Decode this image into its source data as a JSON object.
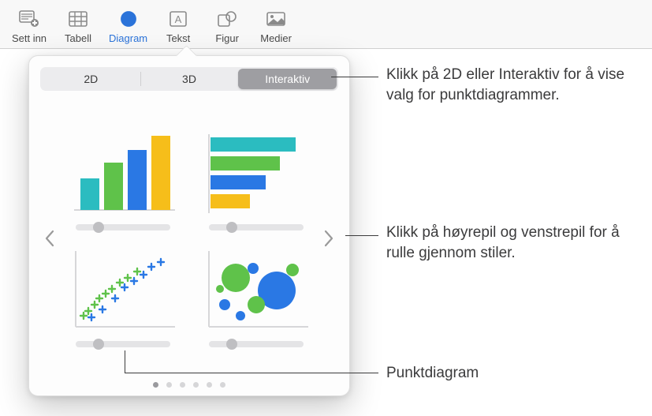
{
  "toolbar": {
    "items": [
      {
        "label": "Sett inn",
        "icon": "insert-icon"
      },
      {
        "label": "Tabell",
        "icon": "table-icon"
      },
      {
        "label": "Diagram",
        "icon": "chart-pie-icon",
        "active": true
      },
      {
        "label": "Tekst",
        "icon": "text-icon"
      },
      {
        "label": "Figur",
        "icon": "shape-icon"
      },
      {
        "label": "Medier",
        "icon": "media-icon"
      }
    ]
  },
  "chart_popover": {
    "tabs": {
      "tab_2d": "2D",
      "tab_3d": "3D",
      "tab_interactive": "Interaktiv",
      "active": "Interaktiv"
    },
    "thumbs": [
      {
        "name": "vertical-bar-chart"
      },
      {
        "name": "horizontal-bar-chart"
      },
      {
        "name": "scatter-chart"
      },
      {
        "name": "bubble-chart"
      }
    ],
    "nav": {
      "prev": "‹",
      "next": "›"
    },
    "page_count": 6,
    "current_page": 0,
    "colors": {
      "teal": "#2bbcc0",
      "green": "#5fc24a",
      "blue": "#2a78e4",
      "yellow": "#f6be1a",
      "axis": "#d7d7d9"
    }
  },
  "annotations": {
    "tabs_hint": "Klikk på 2D eller Interaktiv for å vise valg for punktdiagrammer.",
    "arrows_hint": "Klikk på høyrepil og venstrepil for å rulle gjennom stiler.",
    "scatter_label": "Punktdiagram"
  }
}
